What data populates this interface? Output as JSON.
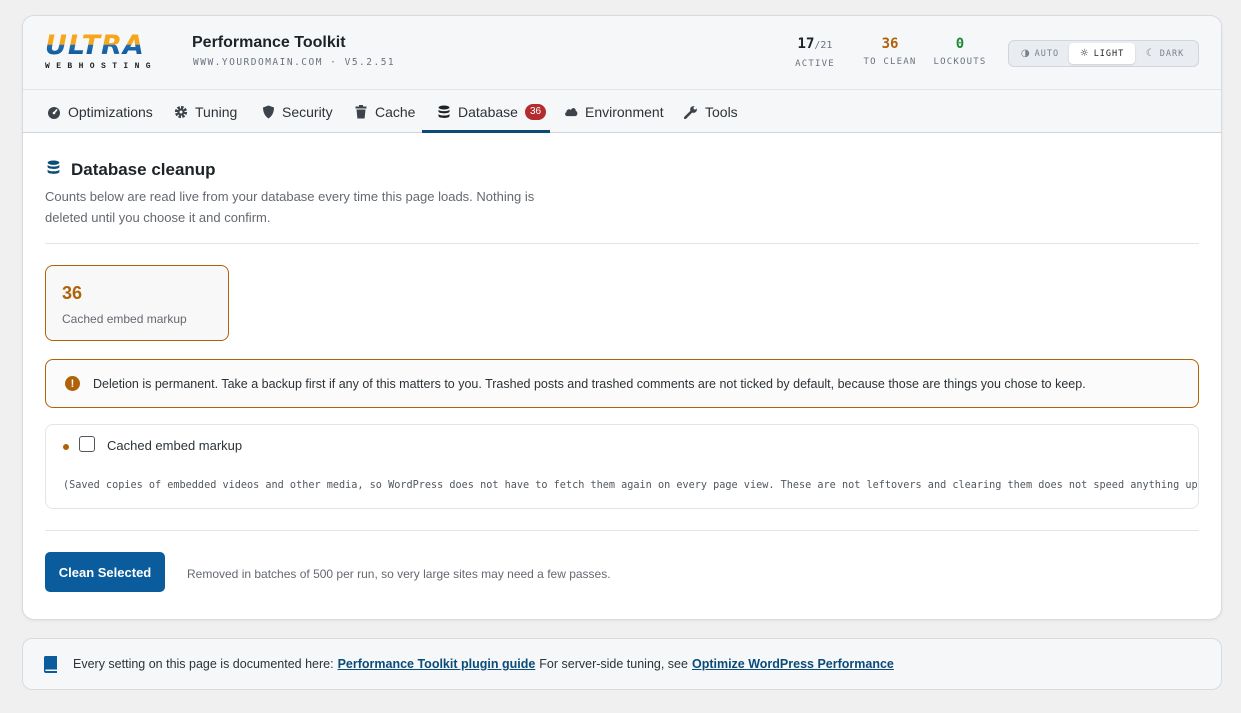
{
  "header": {
    "logo_word": "ULTRA",
    "logo_sub": "WEBHOSTING",
    "title": "Performance Toolkit",
    "subtitle": "WWW.YOURDOMAIN.COM · V5.2.51",
    "stats": {
      "active_value": "17",
      "active_total": "/21",
      "active_label": "ACTIVE",
      "clean_value": "36",
      "clean_label": "TO CLEAN",
      "lockouts_value": "0",
      "lockouts_label": "LOCKOUTS"
    },
    "theme": {
      "auto": "AUTO",
      "light": "LIGHT",
      "dark": "DARK",
      "selected": "LIGHT"
    },
    "colors": {
      "clean": "#b0620a",
      "lockouts": "#1f8a3b",
      "accent": "#0a4b78"
    }
  },
  "tabs": [
    {
      "label": "Optimizations",
      "icon": "gauge-icon"
    },
    {
      "label": "Tuning",
      "icon": "gear-icon"
    },
    {
      "label": "Security",
      "icon": "shield-icon"
    },
    {
      "label": "Cache",
      "icon": "trash-icon"
    },
    {
      "label": "Database",
      "icon": "database-icon",
      "badge": "36",
      "active": true
    },
    {
      "label": "Environment",
      "icon": "cloud-icon"
    },
    {
      "label": "Tools",
      "icon": "wrench-icon"
    }
  ],
  "section": {
    "title": "Database cleanup",
    "description": "Counts below are read live from your database every time this page loads. Nothing is deleted until you choose it and confirm."
  },
  "summary_card": {
    "count": "36",
    "label": "Cached embed markup"
  },
  "warning": "Deletion is permanent. Take a backup first if any of this matters to you. Trashed posts and trashed comments are not ticked by default, because those are things you chose to keep.",
  "cleanup_item": {
    "label": "Cached embed markup",
    "checked": false,
    "description": "(Saved copies of embedded videos and other media, so WordPress does not have to fetch them again on every page view. These are not leftovers and clearing them does not speed anything up: t"
  },
  "actions": {
    "clean_label": "Clean Selected",
    "note": "Removed in batches of 500 per run, so very large sites may need a few passes."
  },
  "footer": {
    "text_before": "Every setting on this page is documented here:",
    "link1": "Performance Toolkit plugin guide",
    "text_middle": "For server-side tuning, see",
    "link2": "Optimize WordPress Performance"
  }
}
